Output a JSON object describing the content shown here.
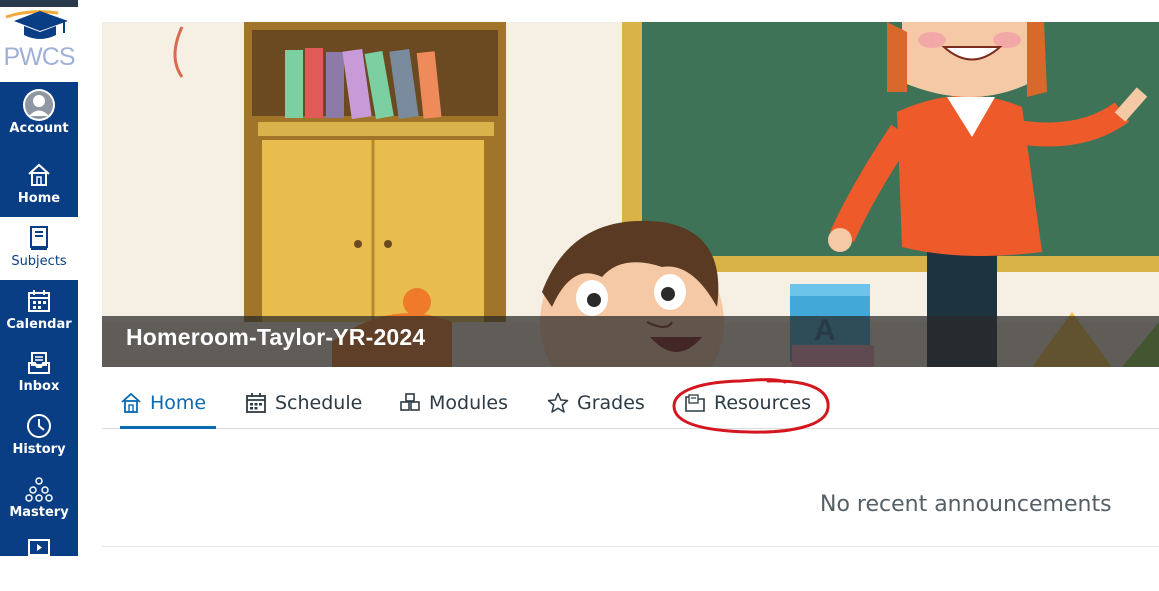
{
  "logo": {
    "text": "PWCS"
  },
  "nav": {
    "items": [
      {
        "label": "Account",
        "icon": "user-avatar-icon",
        "active": false
      },
      {
        "label": "Home",
        "icon": "home-icon",
        "active": false
      },
      {
        "label": "Subjects",
        "icon": "book-icon",
        "active": true
      },
      {
        "label": "Calendar",
        "icon": "calendar-icon",
        "active": false
      },
      {
        "label": "Inbox",
        "icon": "inbox-icon",
        "active": false
      },
      {
        "label": "History",
        "icon": "clock-icon",
        "active": false
      },
      {
        "label": "Mastery",
        "icon": "mastery-icon",
        "active": false
      },
      {
        "label": "",
        "icon": "studio-icon",
        "active": false
      }
    ]
  },
  "banner": {
    "title": "Homeroom-Taylor-YR-2024"
  },
  "tabs": [
    {
      "label": "Home",
      "icon": "home-icon",
      "active": true
    },
    {
      "label": "Schedule",
      "icon": "calendar-icon",
      "active": false
    },
    {
      "label": "Modules",
      "icon": "modules-icon",
      "active": false
    },
    {
      "label": "Grades",
      "icon": "star-icon",
      "active": false
    },
    {
      "label": "Resources",
      "icon": "folder-icon",
      "active": false,
      "highlighted": true
    }
  ],
  "announcements": {
    "empty_text": "No recent announcements"
  },
  "colors": {
    "nav_bg": "#0a3e84",
    "active_tab": "#0a6ab2",
    "highlight_circle": "#d4161e"
  }
}
